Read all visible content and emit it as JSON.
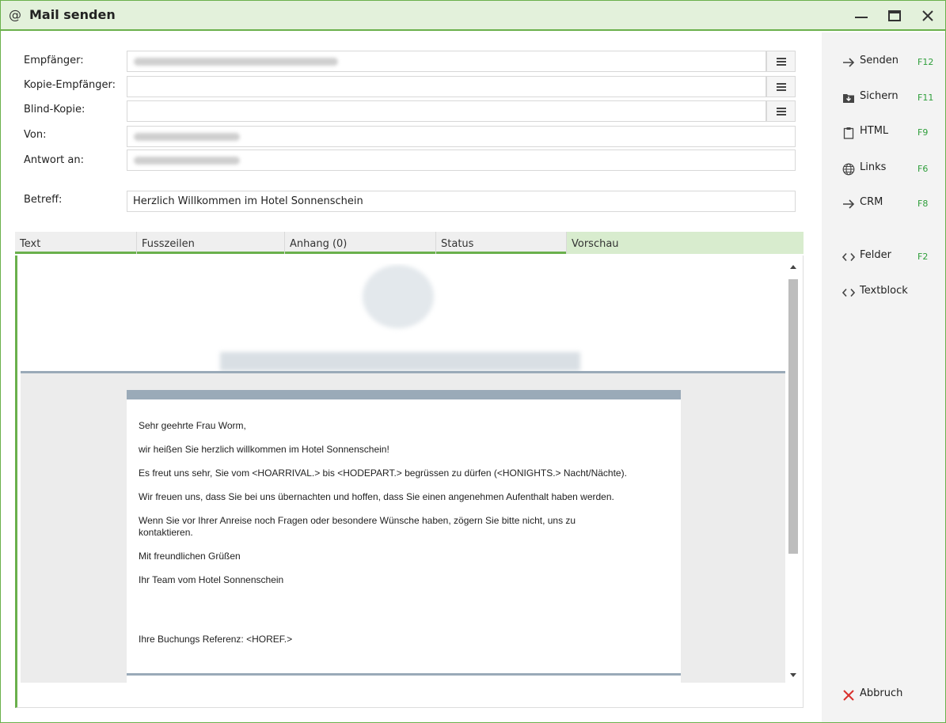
{
  "window": {
    "title": "Mail senden",
    "icon": "at-icon"
  },
  "fields": {
    "to_label": "Empfänger:",
    "cc_label": "Kopie-Empfänger:",
    "bcc_label": "Blind-Kopie:",
    "from_label": "Von:",
    "reply_label": "Antwort an:",
    "subject_label": "Betreff:",
    "subject_value": "Herzlich Willkommen im Hotel Sonnenschein"
  },
  "tabs": [
    {
      "label": "Text"
    },
    {
      "label": "Fusszeilen"
    },
    {
      "label": "Anhang (0)"
    },
    {
      "label": "Status"
    },
    {
      "label": "Vorschau"
    }
  ],
  "preview": {
    "lines": [
      "Sehr geehrte Frau Worm,",
      "wir heißen Sie herzlich willkommen im Hotel Sonnenschein!",
      "Es freut uns sehr, Sie vom <HOARRIVAL.> bis <HODEPART.> begrüssen zu dürfen (<HONIGHTS.> Nacht/Nächte).",
      "Wir freuen uns, dass Sie bei uns übernachten und hoffen, dass Sie einen angenehmen Aufenthalt haben werden.",
      "Wenn Sie vor Ihrer Anreise noch Fragen oder besondere Wünsche haben, zögern Sie bitte nicht, uns zu kontaktieren.",
      "Mit freundlichen Grüßen",
      "Ihr Team vom Hotel Sonnenschein",
      "Ihre Buchungs Referenz: <HOREF.>"
    ]
  },
  "actions": [
    {
      "label": "Senden",
      "key": "F12",
      "icon": "arrow-right-icon"
    },
    {
      "label": "Sichern",
      "key": "F11",
      "icon": "save-folder-icon"
    },
    {
      "label": "HTML",
      "key": "F9",
      "icon": "clipboard-icon"
    },
    {
      "label": "Links",
      "key": "F6",
      "icon": "globe-icon"
    },
    {
      "label": "CRM",
      "key": "F8",
      "icon": "arrow-right-icon"
    },
    {
      "label": "Felder",
      "key": "F2",
      "icon": "code-icon"
    },
    {
      "label": "Textblock",
      "key": "",
      "icon": "code-icon"
    },
    {
      "label": "Abbruch",
      "key": "",
      "icon": "cancel-x-icon"
    }
  ],
  "colors": {
    "accent": "#6ab04c",
    "header_bg": "#e3f1db",
    "active_tab": "#d8ecce",
    "shortcut": "#2e9e3a",
    "cancel": "#d9302c"
  }
}
